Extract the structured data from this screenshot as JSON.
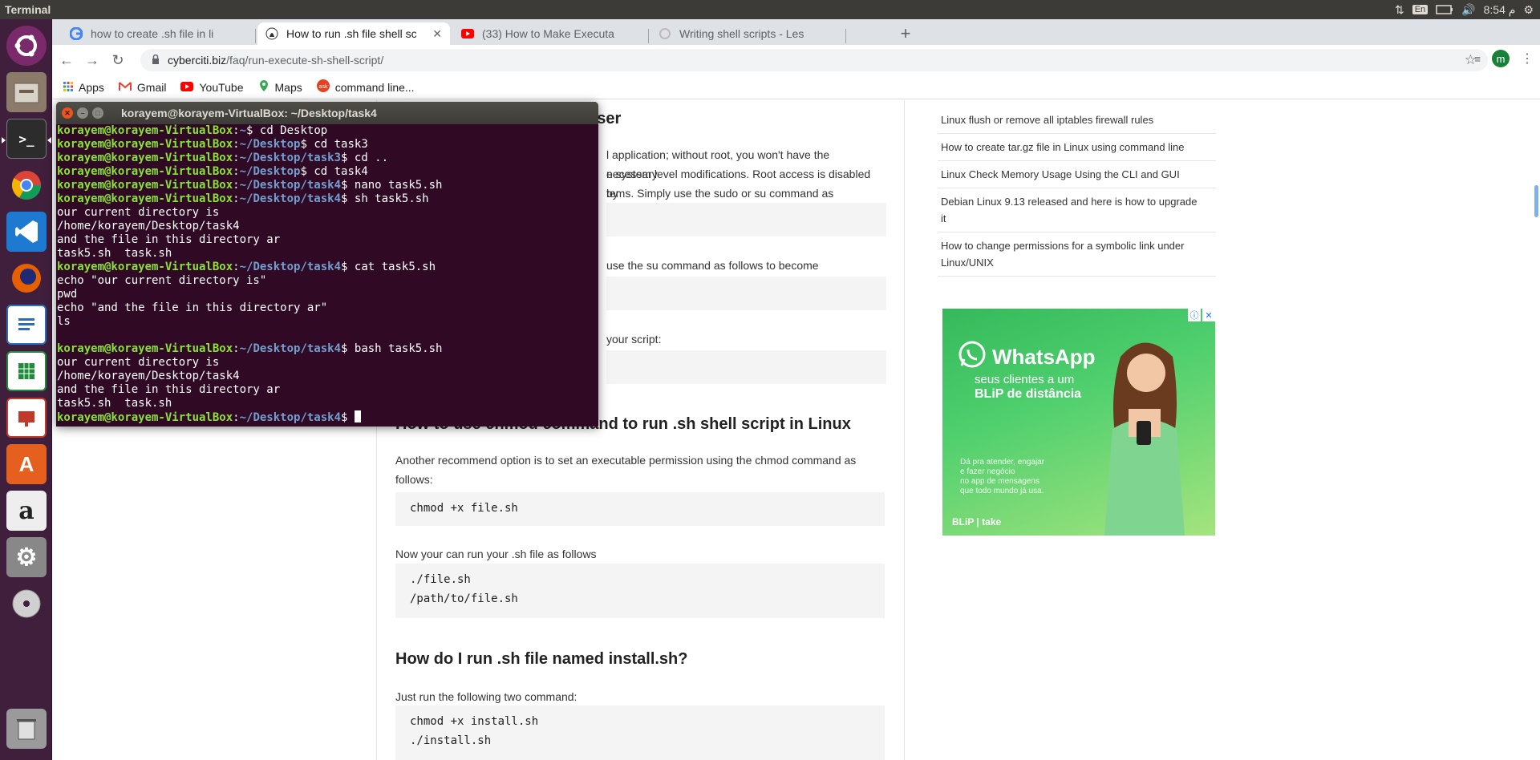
{
  "topbar": {
    "app_name": "Terminal",
    "lang": "En",
    "time": "8:54 م"
  },
  "browser": {
    "tabs": [
      {
        "title": "how to create .sh file in li",
        "icon": "google-icon",
        "active": false
      },
      {
        "title": "How to run .sh file shell sc",
        "icon": "cyberciti-icon",
        "active": true
      },
      {
        "title": "(33) How to Make Executa",
        "icon": "youtube-icon",
        "active": false
      },
      {
        "title": "Writing shell scripts - Les",
        "icon": "loading-icon",
        "active": false
      }
    ],
    "url_host": "cyberciti.biz",
    "url_path": "/faq/run-execute-sh-shell-script/",
    "profile_initial": "m",
    "bookmarks": [
      {
        "label": "Apps",
        "icon": "apps-grid-icon"
      },
      {
        "label": "Gmail",
        "icon": "gmail-icon"
      },
      {
        "label": "YouTube",
        "icon": "youtube-icon"
      },
      {
        "label": "Maps",
        "icon": "maps-icon"
      },
      {
        "label": "command line...",
        "icon": "ask-icon"
      }
    ]
  },
  "page": {
    "partial": {
      "heading_tail": "user",
      "line1": "l application; without root, you won't have the necessary",
      "line2": "e system level modifications. Root access is disabled by",
      "line3": "tems. Simply use the sudo or su command as follows:",
      "line4": "use the su command as follows to become superuser:",
      "line5": "your script:"
    },
    "h_chmod": "How to use chmod command to run .sh shell script in Linux",
    "p_chmod": "Another recommend option is to set an executable permission using the chmod command as follows:",
    "code_chmod": "chmod +x file.sh",
    "p_run": "Now your can run your .sh file as follows",
    "code_run_1": "./file.sh",
    "code_run_2": "/path/to/file.sh",
    "h_install": "How do I run .sh file named install.sh?",
    "p_install": "Just run the following two command:",
    "code_install_1": "chmod +x install.sh",
    "code_install_2": "./install.sh"
  },
  "sidebar": {
    "related": [
      "Linux flush or remove all iptables firewall rules",
      "How to create tar.gz file in Linux using command line",
      "Linux Check Memory Usage Using the CLI and GUI",
      "Debian Linux 9.13 released and here is how to upgrade it",
      "How to change permissions for a symbolic link under Linux/UNIX"
    ],
    "ad": {
      "brand": "WhatsApp",
      "tag_line1": "seus clientes a um",
      "tag_line2": "BLiP de distância",
      "small_1": "Dá pra atender, engajar",
      "small_2": "e fazer negócio",
      "small_3": "no app de mensagens",
      "small_4": "que todo mundo já usa.",
      "footer": "BLiP | take",
      "brand_color": "#25d366"
    }
  },
  "terminal": {
    "title": "korayem@korayem-VirtualBox: ~/Desktop/task4",
    "user_host": "korayem@korayem-VirtualBox",
    "lines": [
      {
        "type": "prompt",
        "path": "~",
        "cmd": " cd Desktop"
      },
      {
        "type": "prompt",
        "path": "~/Desktop",
        "cmd": " cd task3"
      },
      {
        "type": "prompt",
        "path": "~/Desktop/task3",
        "cmd": " cd .."
      },
      {
        "type": "prompt",
        "path": "~/Desktop",
        "cmd": " cd task4"
      },
      {
        "type": "prompt",
        "path": "~/Desktop/task4",
        "cmd": " nano task5.sh"
      },
      {
        "type": "prompt",
        "path": "~/Desktop/task4",
        "cmd": " sh task5.sh"
      },
      {
        "type": "out",
        "text": "our current directory is"
      },
      {
        "type": "out",
        "text": "/home/korayem/Desktop/task4"
      },
      {
        "type": "out",
        "text": "and the file in this directory ar"
      },
      {
        "type": "out",
        "text": "task5.sh  task.sh"
      },
      {
        "type": "prompt",
        "path": "~/Desktop/task4",
        "cmd": " cat task5.sh"
      },
      {
        "type": "out",
        "text": "echo \"our current directory is\""
      },
      {
        "type": "out",
        "text": "pwd"
      },
      {
        "type": "out",
        "text": "echo \"and the file in this directory ar\""
      },
      {
        "type": "out",
        "text": "ls"
      },
      {
        "type": "out",
        "text": ""
      },
      {
        "type": "prompt",
        "path": "~/Desktop/task4",
        "cmd": " bash task5.sh"
      },
      {
        "type": "out",
        "text": "our current directory is"
      },
      {
        "type": "out",
        "text": "/home/korayem/Desktop/task4"
      },
      {
        "type": "out",
        "text": "and the file in this directory ar"
      },
      {
        "type": "out",
        "text": "task5.sh  task.sh"
      },
      {
        "type": "prompt",
        "path": "~/Desktop/task4",
        "cmd": " ",
        "cursor": true
      }
    ]
  },
  "launcher": [
    {
      "name": "ubuntu-dash-icon",
      "color": "#7a2a6a"
    },
    {
      "name": "files-icon",
      "color": "#8c7b6b"
    },
    {
      "name": "terminal-icon",
      "color": "#2c2c2c"
    },
    {
      "name": "chrome-icon",
      "color": "#4a4a4a"
    },
    {
      "name": "vscode-icon",
      "color": "#1e7ad0"
    },
    {
      "name": "firefox-icon",
      "color": "#e66000"
    },
    {
      "name": "writer-icon",
      "color": "#2a6ebb"
    },
    {
      "name": "calc-icon",
      "color": "#1e8c3a"
    },
    {
      "name": "impress-icon",
      "color": "#c0392b"
    },
    {
      "name": "software-center-icon",
      "color": "#e5601f"
    },
    {
      "name": "amazon-icon",
      "color": "#eeeeee"
    },
    {
      "name": "settings-icon",
      "color": "#888888"
    },
    {
      "name": "dvd-icon",
      "color": "#d0d0d0"
    },
    {
      "name": "trash-icon",
      "color": "#9a9a9a"
    }
  ]
}
